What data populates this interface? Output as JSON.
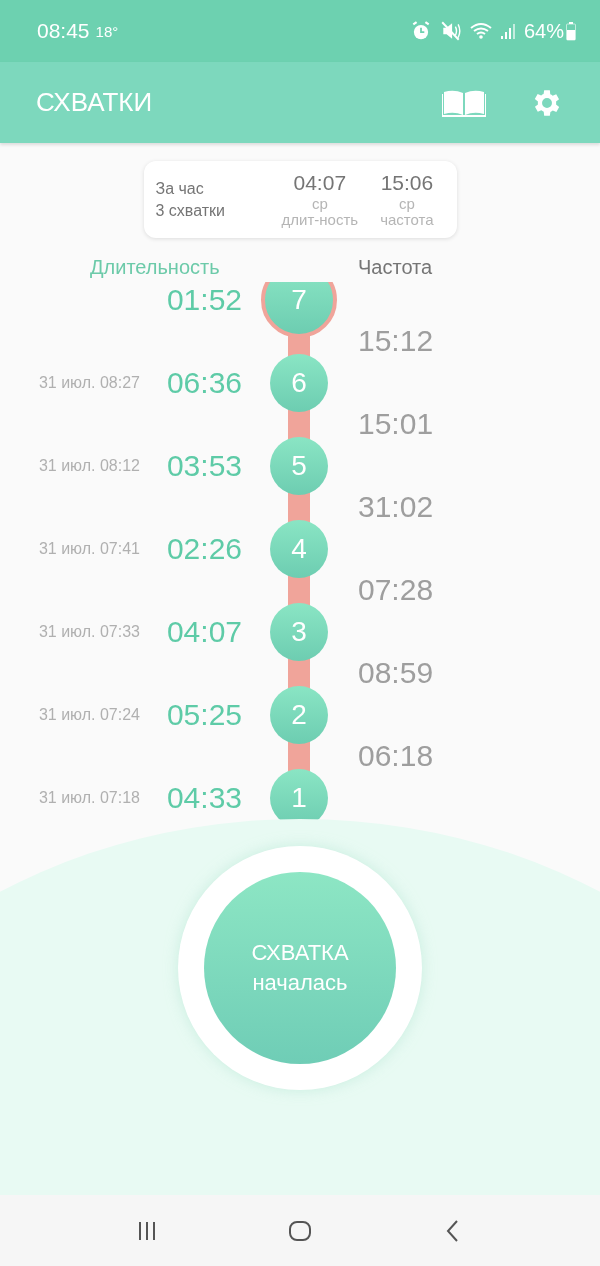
{
  "status_bar": {
    "time": "08:45",
    "temperature": "18°",
    "battery": "64%"
  },
  "app_bar": {
    "title": "СХВАТКИ"
  },
  "summary": {
    "period": "За час",
    "count": "3 схватки",
    "stats": [
      {
        "value": "04:07",
        "qualifier": "ср",
        "label": "длит-ность"
      },
      {
        "value": "15:06",
        "qualifier": "ср",
        "label": "частота"
      }
    ]
  },
  "columns": [
    {
      "label": "Длительность",
      "kind": "duration"
    },
    {
      "label": "Частота",
      "kind": "frequency"
    }
  ],
  "contractions": [
    {
      "number": "7",
      "duration": "01:52",
      "frequency": "15:12",
      "active": true
    },
    {
      "number": "6",
      "date": "31 июл. 08:27",
      "duration": "06:36",
      "frequency": "15:01",
      "active": false
    },
    {
      "number": "5",
      "date": "31 июл. 08:12",
      "duration": "03:53",
      "frequency": "31:02",
      "active": false
    },
    {
      "number": "4",
      "date": "31 июл. 07:41",
      "duration": "02:26",
      "frequency": "07:28",
      "active": false
    },
    {
      "number": "3",
      "date": "31 июл. 07:33",
      "duration": "04:07",
      "frequency": "08:59",
      "active": false
    },
    {
      "number": "2",
      "date": "31 июл. 07:24",
      "duration": "05:25",
      "frequency": "06:18",
      "active": false
    },
    {
      "number": "1",
      "date": "31 июл. 07:18",
      "duration": "04:33",
      "active": false
    }
  ],
  "start_button": {
    "line_1": "СХВАТКА",
    "line_2": "началась"
  }
}
